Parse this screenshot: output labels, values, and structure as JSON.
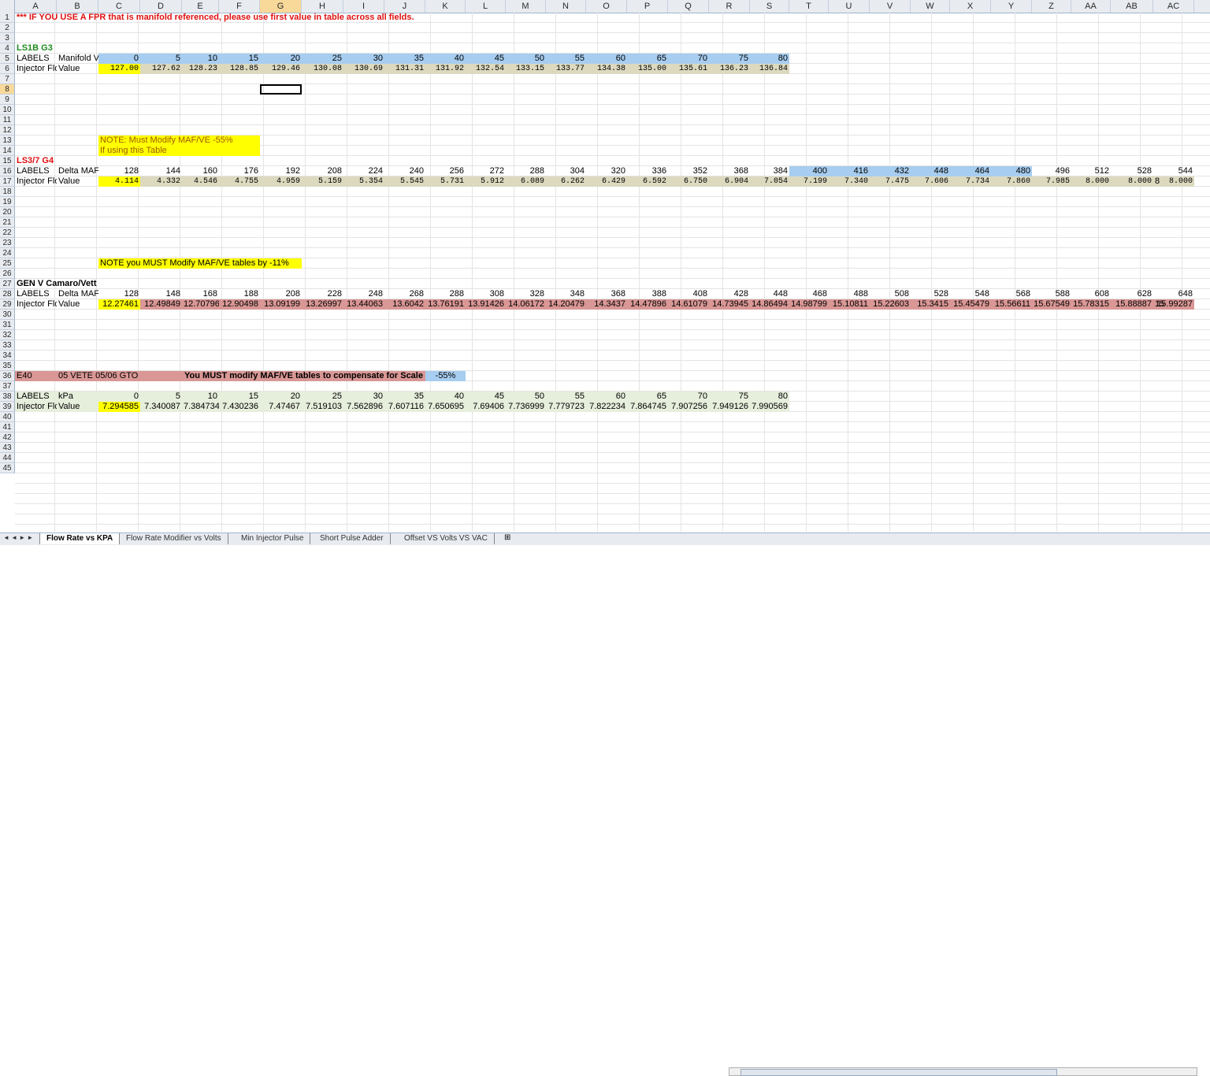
{
  "columns": [
    "A",
    "B",
    "C",
    "D",
    "E",
    "F",
    "G",
    "H",
    "I",
    "J",
    "K",
    "L",
    "M",
    "N",
    "O",
    "P",
    "Q",
    "R",
    "S",
    "T",
    "U",
    "V",
    "W",
    "X",
    "Y",
    "Z",
    "AA",
    "AB",
    "AC"
  ],
  "selected_column": "G",
  "selected_row": "8",
  "rows": [
    "1",
    "2",
    "3",
    "4",
    "5",
    "6",
    "7",
    "8",
    "9",
    "10",
    "11",
    "12",
    "13",
    "14",
    "15",
    "16",
    "17",
    "18",
    "19",
    "20",
    "21",
    "22",
    "23",
    "24",
    "25",
    "26",
    "27",
    "28",
    "29",
    "30",
    "31",
    "32",
    "33",
    "34",
    "35",
    "36",
    "37",
    "38",
    "39",
    "40",
    "41",
    "42",
    "43",
    "44",
    "45"
  ],
  "notice": "*** IF YOU USE A FPR that is manifold referenced, please use first value in table across all fields.",
  "ls1b": {
    "title": "LS1B G3",
    "label_a": "LABELS",
    "label_b": "Manifold V",
    "row_a": "Injector Flo",
    "row_b": "Value",
    "headers": [
      "0",
      "5",
      "10",
      "15",
      "20",
      "25",
      "30",
      "35",
      "40",
      "45",
      "50",
      "55",
      "60",
      "65",
      "70",
      "75",
      "80"
    ],
    "values": [
      "127.00",
      "127.62",
      "128.23",
      "128.85",
      "129.46",
      "130.08",
      "130.69",
      "131.31",
      "131.92",
      "132.54",
      "133.15",
      "133.77",
      "134.38",
      "135.00",
      "135.61",
      "136.23",
      "136.84"
    ]
  },
  "note1": {
    "line1": "NOTE:  Must Modify MAF/VE -55%",
    "line2": "If using this Table"
  },
  "ls3": {
    "title": "LS3/7 G4",
    "label_a": "LABELS",
    "label_b": "Delta MAF",
    "row_a": "Injector Flo",
    "row_b": "Value",
    "headers": [
      "128",
      "144",
      "160",
      "176",
      "192",
      "208",
      "224",
      "240",
      "256",
      "272",
      "288",
      "304",
      "320",
      "336",
      "352",
      "368",
      "384",
      "400",
      "416",
      "432",
      "448",
      "464",
      "480",
      "496",
      "512",
      "528",
      "544"
    ],
    "values": [
      "4.114",
      "4.332",
      "4.546",
      "4.755",
      "4.959",
      "5.159",
      "5.354",
      "5.545",
      "5.731",
      "5.912",
      "6.089",
      "6.262",
      "6.429",
      "6.592",
      "6.750",
      "6.904",
      "7.054",
      "7.199",
      "7.340",
      "7.475",
      "7.606",
      "7.734",
      "7.860",
      "7.985",
      "8.000",
      "8.000",
      "8.000"
    ],
    "overflow": "8"
  },
  "note2": "NOTE you MUST Modify MAF/VE tables by -11%",
  "gen5": {
    "title": "GEN V Camaro/Vett",
    "label_a": "LABELS",
    "label_b": "Delta MAF",
    "row_a": "Injector Flo",
    "row_b": "Value",
    "headers": [
      "128",
      "148",
      "168",
      "188",
      "208",
      "228",
      "248",
      "268",
      "288",
      "308",
      "328",
      "348",
      "368",
      "388",
      "408",
      "428",
      "448",
      "468",
      "488",
      "508",
      "528",
      "548",
      "568",
      "588",
      "608",
      "628",
      "648"
    ],
    "values": [
      "12.27461",
      "12.49849",
      "12.70796",
      "12.90498",
      "13.09199",
      "13.26997",
      "13.44063",
      "13.6042",
      "13.76191",
      "13.91426",
      "14.06172",
      "14.20479",
      "14.3437",
      "14.47896",
      "14.61079",
      "14.73945",
      "14.86494",
      "14.98799",
      "15.10811",
      "15.22603",
      "15.3415",
      "15.45479",
      "15.56611",
      "15.67549",
      "15.78315",
      "15.88887",
      "15.99287"
    ],
    "overflow": "15"
  },
  "e40": {
    "col_a": "E40",
    "col_b": "05 VETE 05/06 GTO",
    "warning": "You MUST modify MAF/VE tables to compensate for Scale",
    "percent": "-55%",
    "label_a": "LABELS",
    "label_b": "kPa",
    "row_a": "Injector Flo",
    "row_b": "Value",
    "headers": [
      "0",
      "5",
      "10",
      "15",
      "20",
      "25",
      "30",
      "35",
      "40",
      "45",
      "50",
      "55",
      "60",
      "65",
      "70",
      "75",
      "80"
    ],
    "values": [
      "7.294585",
      "7.340087",
      "7.384734",
      "7.430236",
      "7.47467",
      "7.519103",
      "7.562896",
      "7.607116",
      "7.650695",
      "7.69406",
      "7.736999",
      "7.779723",
      "7.822234",
      "7.864745",
      "7.907256",
      "7.949126",
      "7.990569"
    ]
  },
  "tabs": [
    "Flow Rate vs KPA",
    "Flow Rate Modifier vs Volts",
    "Min Injector Pulse",
    "Short Pulse Adder",
    "Offset VS Volts VS VAC"
  ],
  "active_tab": 0,
  "tab_nav": "◄ ◄ ► ►",
  "colors": {
    "blue": "#a7cdf0",
    "yellow": "#ffff00",
    "tan": "#dcd9bf",
    "pink": "#d99795",
    "green_title": "#1f8a1f",
    "red_title": "#e01010"
  }
}
